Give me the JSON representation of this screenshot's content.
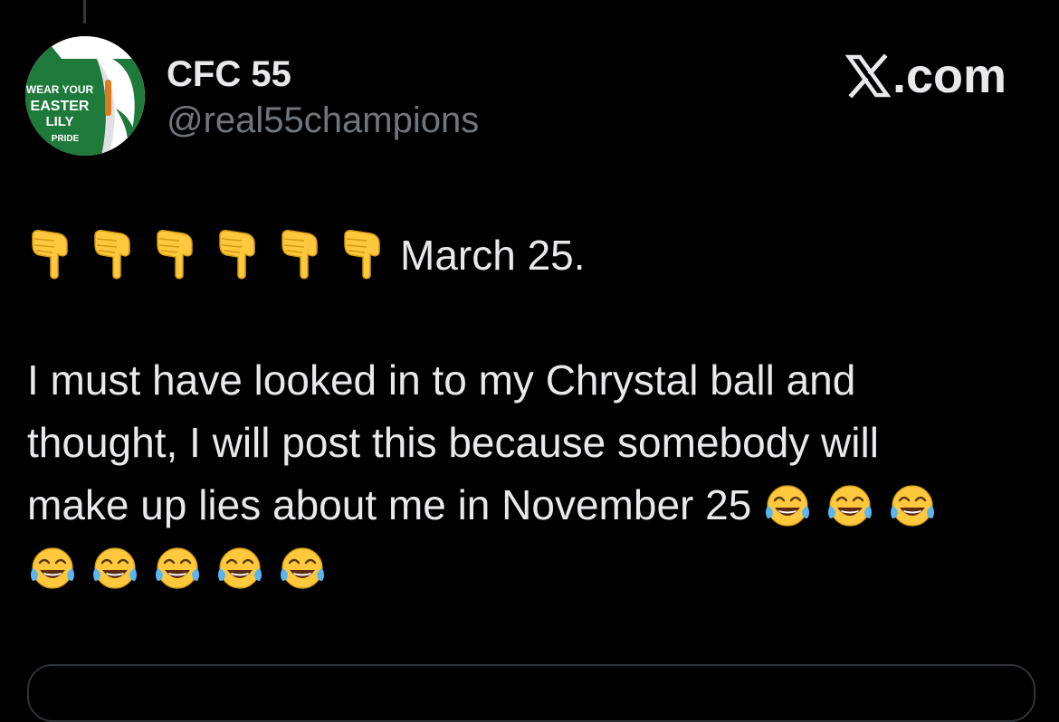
{
  "post": {
    "display_name": "CFC 55",
    "handle": "@real55champions",
    "brand": ".com",
    "brand_icon": "x-logo-icon",
    "avatar": {
      "icon": "easter-lily-avatar",
      "lines": [
        "WEAR YOUR",
        "EASTER",
        "LILY",
        "PRIDE"
      ],
      "colors": {
        "green": "#1e7a3a",
        "orange": "#e07a1e",
        "white": "#ffffff"
      }
    },
    "line1_emoji": [
      "backhand-index-pointing-down",
      "backhand-index-pointing-down",
      "backhand-index-pointing-down",
      "backhand-index-pointing-down",
      "backhand-index-pointing-down",
      "backhand-index-pointing-down"
    ],
    "line1_text": "March 25.",
    "body_lines": [
      "I must have looked in to my Chrystal ball and",
      "thought, I will post this because somebody will",
      "make up lies about me in November 25"
    ],
    "laugh_emoji_line3": [
      "face-with-tears-of-joy",
      "face-with-tears-of-joy",
      "face-with-tears-of-joy"
    ],
    "laugh_emoji_line4": [
      "face-with-tears-of-joy",
      "face-with-tears-of-joy",
      "face-with-tears-of-joy",
      "face-with-tears-of-joy",
      "face-with-tears-of-joy"
    ]
  },
  "colors": {
    "background": "#000000",
    "text": "#e7e9ea",
    "secondary_text": "#71767b",
    "emoji_yellow": "#ffc83d",
    "tear_blue": "#5bb5f0"
  }
}
